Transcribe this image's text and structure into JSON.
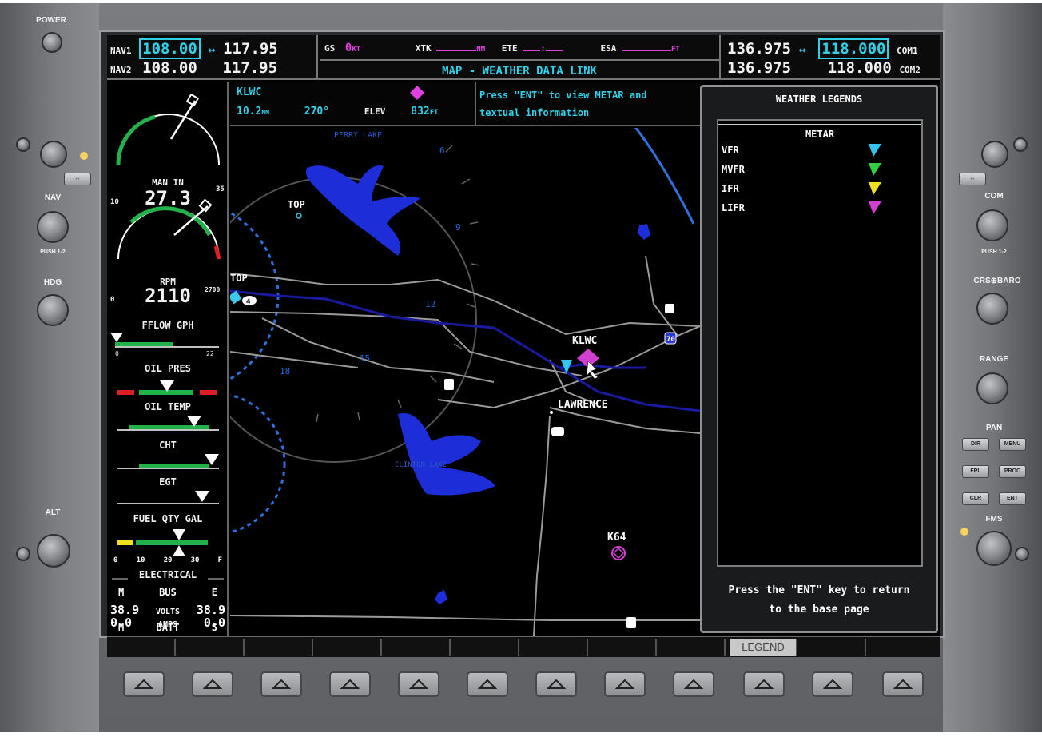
{
  "bezel": {
    "power_label": "POWER",
    "nav_knob_label": "NAV",
    "hdg_knob_label": "HDG",
    "alt_knob_label": "ALT",
    "com_knob_label": "COM",
    "crs_baro_label": "CRS⊕BARO",
    "range_label": "RANGE",
    "pan_label": "PAN",
    "fms_label": "FMS",
    "right_buttons": [
      "DIR",
      "MENU",
      "FPL",
      "PROC",
      "CLR",
      "ENT"
    ],
    "small_push_label_1": "PUSH 1-2",
    "small_push_label_2": "PUSH 1-2"
  },
  "topbar": {
    "nav1_label": "NAV1",
    "nav1_active": "108.00",
    "nav1_arrow": "↔",
    "nav1_standby": "117.95",
    "nav2_label": "NAV2",
    "nav2_active": "108.00",
    "nav2_standby": "117.95",
    "gs_label": "GS",
    "gs_value": "0",
    "gs_unit": "KT",
    "xtk_label": "XTK",
    "xtk_unit": "NM",
    "ete_label": "ETE",
    "ete_value": ":",
    "esa_label": "ESA",
    "esa_unit": "FT",
    "page_title": "MAP - WEATHER DATA LINK",
    "com1_standby": "136.975",
    "com1_arrow": "↔",
    "com1_active": "118.000",
    "com1_label": "COM1",
    "com2_standby": "136.975",
    "com2_active": "118.000",
    "com2_label": "COM2"
  },
  "eis": {
    "man_in_label": "MAN IN",
    "man_in_value": "27.3",
    "man_in_min": "10",
    "man_in_max": "35",
    "rpm_label": "RPM",
    "rpm_value": "2110",
    "rpm_min": "0",
    "rpm_max": "2700",
    "fflow_label": "FFLOW GPH",
    "fflow_min": "0",
    "fflow_max": "22",
    "oil_pres_label": "OIL PRES",
    "oil_temp_label": "OIL TEMP",
    "cht_label": "CHT",
    "egt_label": "EGT",
    "fuel_qty_label": "FUEL QTY GAL",
    "fuel_scale": [
      "0",
      "10",
      "20",
      "30",
      "F"
    ],
    "electrical_label": "ELECTRICAL",
    "bus_m": "M",
    "bus_label": "BUS",
    "bus_e": "E",
    "volts_left": "38.9",
    "volts_label": "VOLTS",
    "volts_right": "38.9",
    "batt_m": "M",
    "batt_label": "BATT",
    "batt_s": "S",
    "amps_left": "0.0",
    "amps_label": "AMPS",
    "amps_right": "0.0"
  },
  "info_strip": {
    "ident": "KLWC",
    "distance": "10.2",
    "distance_unit": "NM",
    "bearing": "270°",
    "elev_label": "ELEV",
    "elev_value": "832",
    "elev_unit": "FT",
    "message_line1": "Press \"ENT\" to view METAR and",
    "message_line2": "textual information"
  },
  "map": {
    "labels": {
      "perry_lake": "PERRY LAKE",
      "top1": "TOP",
      "top2": "TOP",
      "klwc": "KLWC",
      "lawrence": "LAWRENCE",
      "clinton_lake": "CLINTON LAKE",
      "k64": "K64",
      "highway_70": "70",
      "ring_6": "6",
      "ring_9": "9",
      "ring_12": "12",
      "ring_15": "15",
      "ring_18": "18",
      "road_4": "4"
    }
  },
  "legend_panel": {
    "title": "WEATHER LEGENDS",
    "section": "METAR",
    "items": [
      {
        "label": "VFR",
        "color": "#30c8f0"
      },
      {
        "label": "MVFR",
        "color": "#30d040"
      },
      {
        "label": "IFR",
        "color": "#f0e020"
      },
      {
        "label": "LIFR",
        "color": "#d040d0"
      }
    ],
    "footer_line1": "Press the \"ENT\" key to return",
    "footer_line2": "to the base page"
  },
  "softkeys": {
    "legend_label": "LEGEND"
  }
}
